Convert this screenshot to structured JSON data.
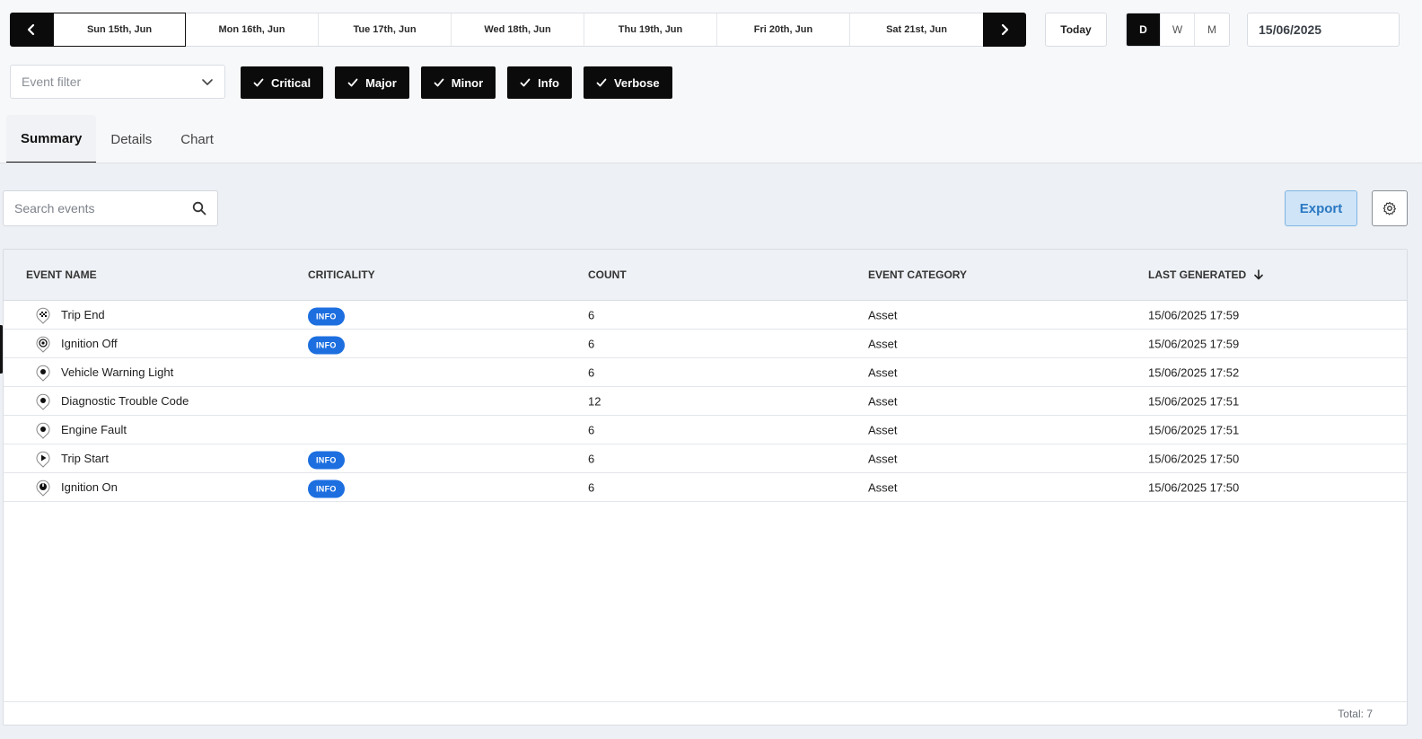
{
  "date_nav": {
    "days": [
      "Sun 15th, Jun",
      "Mon 16th, Jun",
      "Tue 17th, Jun",
      "Wed 18th, Jun",
      "Thu 19th, Jun",
      "Fri 20th, Jun",
      "Sat 21st, Jun"
    ],
    "active_day": 0,
    "today_label": "Today",
    "periods": [
      "D",
      "W",
      "M"
    ],
    "active_period": "D",
    "date_value": "15/06/2025"
  },
  "filters": {
    "event_filter_placeholder": "Event filter",
    "chips": [
      "Critical",
      "Major",
      "Minor",
      "Info",
      "Verbose"
    ]
  },
  "tabs": [
    "Summary",
    "Details",
    "Chart"
  ],
  "active_tab": "Summary",
  "toolbar": {
    "search_placeholder": "Search events",
    "export_label": "Export"
  },
  "table": {
    "columns": [
      "EVENT NAME",
      "CRITICALITY",
      "COUNT",
      "EVENT CATEGORY",
      "LAST GENERATED"
    ],
    "sort_column": "LAST GENERATED",
    "sort_direction": "descending",
    "rows": [
      {
        "icon": "checkered-flag-icon",
        "name": "Trip End",
        "criticality": "INFO",
        "count": "6",
        "category": "Asset",
        "last_generated": "15/06/2025 17:59"
      },
      {
        "icon": "ignition-off-icon",
        "name": "Ignition Off",
        "criticality": "INFO",
        "count": "6",
        "category": "Asset",
        "last_generated": "15/06/2025 17:59"
      },
      {
        "icon": "location-pin-icon",
        "name": "Vehicle Warning Light",
        "criticality": "",
        "count": "6",
        "category": "Asset",
        "last_generated": "15/06/2025 17:52"
      },
      {
        "icon": "location-pin-icon",
        "name": "Diagnostic Trouble Code",
        "criticality": "",
        "count": "12",
        "category": "Asset",
        "last_generated": "15/06/2025 17:51"
      },
      {
        "icon": "location-pin-icon",
        "name": "Engine Fault",
        "criticality": "",
        "count": "6",
        "category": "Asset",
        "last_generated": "15/06/2025 17:51"
      },
      {
        "icon": "play-icon",
        "name": "Trip Start",
        "criticality": "INFO",
        "count": "6",
        "category": "Asset",
        "last_generated": "15/06/2025 17:50"
      },
      {
        "icon": "ignition-on-icon",
        "name": "Ignition On",
        "criticality": "INFO",
        "count": "6",
        "category": "Asset",
        "last_generated": "15/06/2025 17:50"
      }
    ],
    "total_label": "Total: 7"
  },
  "colors": {
    "badge_info": "#1d6fe0",
    "export_bg": "#cfe4f7",
    "export_text": "#2a78c2",
    "dark": "#0b0b0b"
  }
}
